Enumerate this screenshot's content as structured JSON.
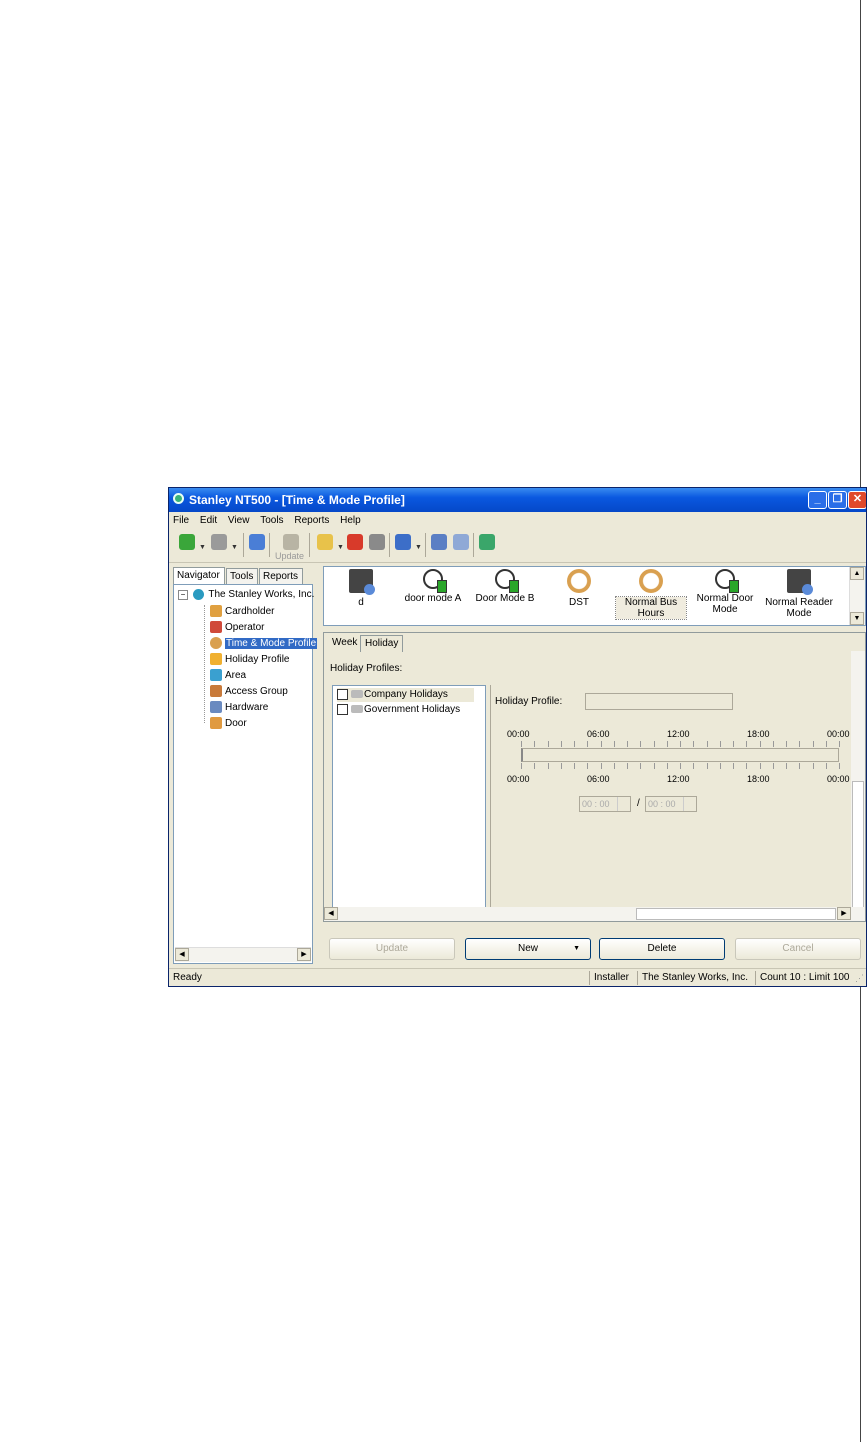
{
  "window": {
    "title": "Stanley NT500 - [Time & Mode Profile]",
    "controls": {
      "minimize": "_",
      "restore": "❐",
      "close": "✕"
    }
  },
  "menu": [
    "File",
    "Edit",
    "View",
    "Tools",
    "Reports",
    "Help"
  ],
  "toolbar": {
    "update_label": "Update"
  },
  "nav": {
    "tabs": [
      "Navigator",
      "Tools",
      "Reports"
    ],
    "root": "The Stanley Works, Inc.",
    "items": [
      "Cardholder",
      "Operator",
      "Time & Mode Profile",
      "Holiday Profile",
      "Area",
      "Access Group",
      "Hardware",
      "Door"
    ]
  },
  "profiles": [
    {
      "label": "d",
      "icon": "reader-mode-icon"
    },
    {
      "label": "door mode A",
      "icon": "door-mode-icon"
    },
    {
      "label": "Door Mode B",
      "icon": "door-mode-icon"
    },
    {
      "label": "DST",
      "icon": "dst-clock-icon"
    },
    {
      "label": "Normal Bus Hours",
      "icon": "dst-clock-icon"
    },
    {
      "label": "Normal Door Mode",
      "icon": "door-mode-icon"
    },
    {
      "label": "Normal Reader Mode",
      "icon": "reader-mode-icon"
    }
  ],
  "detail": {
    "tabs": [
      "Week",
      "Holiday"
    ],
    "section_label": "Holiday Profiles:",
    "holiday_profiles": [
      "Company Holidays",
      "Government Holidays"
    ],
    "field_label": "Holiday Profile:",
    "scale_labels": [
      "00:00",
      "06:00",
      "12:00",
      "18:00",
      "00:00"
    ],
    "start_time": "00 : 00",
    "end_time": "00 : 00",
    "separator": "/"
  },
  "buttons": {
    "update": "Update",
    "new": "New",
    "delete": "Delete",
    "cancel": "Cancel"
  },
  "status": {
    "left": "Ready",
    "user": "Installer",
    "company": "The Stanley Works, Inc.",
    "count": "Count 10 : Limit 100"
  },
  "colors": {
    "title_blue": "#0a58e0",
    "selection": "#316ac5",
    "window_bg": "#ece9d8"
  }
}
